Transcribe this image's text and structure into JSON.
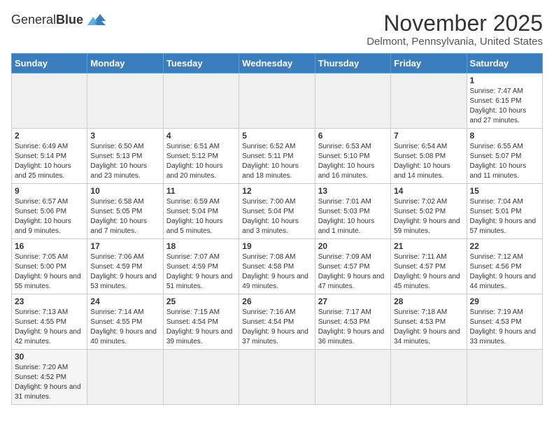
{
  "header": {
    "logo_general": "General",
    "logo_blue": "Blue",
    "month": "November 2025",
    "location": "Delmont, Pennsylvania, United States"
  },
  "days_of_week": [
    "Sunday",
    "Monday",
    "Tuesday",
    "Wednesday",
    "Thursday",
    "Friday",
    "Saturday"
  ],
  "weeks": [
    [
      {
        "day": "",
        "info": ""
      },
      {
        "day": "",
        "info": ""
      },
      {
        "day": "",
        "info": ""
      },
      {
        "day": "",
        "info": ""
      },
      {
        "day": "",
        "info": ""
      },
      {
        "day": "",
        "info": ""
      },
      {
        "day": "1",
        "info": "Sunrise: 7:47 AM\nSunset: 6:15 PM\nDaylight: 10 hours and 27 minutes."
      }
    ],
    [
      {
        "day": "2",
        "info": "Sunrise: 6:49 AM\nSunset: 5:14 PM\nDaylight: 10 hours and 25 minutes."
      },
      {
        "day": "3",
        "info": "Sunrise: 6:50 AM\nSunset: 5:13 PM\nDaylight: 10 hours and 23 minutes."
      },
      {
        "day": "4",
        "info": "Sunrise: 6:51 AM\nSunset: 5:12 PM\nDaylight: 10 hours and 20 minutes."
      },
      {
        "day": "5",
        "info": "Sunrise: 6:52 AM\nSunset: 5:11 PM\nDaylight: 10 hours and 18 minutes."
      },
      {
        "day": "6",
        "info": "Sunrise: 6:53 AM\nSunset: 5:10 PM\nDaylight: 10 hours and 16 minutes."
      },
      {
        "day": "7",
        "info": "Sunrise: 6:54 AM\nSunset: 5:08 PM\nDaylight: 10 hours and 14 minutes."
      },
      {
        "day": "8",
        "info": "Sunrise: 6:55 AM\nSunset: 5:07 PM\nDaylight: 10 hours and 11 minutes."
      }
    ],
    [
      {
        "day": "9",
        "info": "Sunrise: 6:57 AM\nSunset: 5:06 PM\nDaylight: 10 hours and 9 minutes."
      },
      {
        "day": "10",
        "info": "Sunrise: 6:58 AM\nSunset: 5:05 PM\nDaylight: 10 hours and 7 minutes."
      },
      {
        "day": "11",
        "info": "Sunrise: 6:59 AM\nSunset: 5:04 PM\nDaylight: 10 hours and 5 minutes."
      },
      {
        "day": "12",
        "info": "Sunrise: 7:00 AM\nSunset: 5:04 PM\nDaylight: 10 hours and 3 minutes."
      },
      {
        "day": "13",
        "info": "Sunrise: 7:01 AM\nSunset: 5:03 PM\nDaylight: 10 hours and 1 minute."
      },
      {
        "day": "14",
        "info": "Sunrise: 7:02 AM\nSunset: 5:02 PM\nDaylight: 9 hours and 59 minutes."
      },
      {
        "day": "15",
        "info": "Sunrise: 7:04 AM\nSunset: 5:01 PM\nDaylight: 9 hours and 57 minutes."
      }
    ],
    [
      {
        "day": "16",
        "info": "Sunrise: 7:05 AM\nSunset: 5:00 PM\nDaylight: 9 hours and 55 minutes."
      },
      {
        "day": "17",
        "info": "Sunrise: 7:06 AM\nSunset: 4:59 PM\nDaylight: 9 hours and 53 minutes."
      },
      {
        "day": "18",
        "info": "Sunrise: 7:07 AM\nSunset: 4:59 PM\nDaylight: 9 hours and 51 minutes."
      },
      {
        "day": "19",
        "info": "Sunrise: 7:08 AM\nSunset: 4:58 PM\nDaylight: 9 hours and 49 minutes."
      },
      {
        "day": "20",
        "info": "Sunrise: 7:09 AM\nSunset: 4:57 PM\nDaylight: 9 hours and 47 minutes."
      },
      {
        "day": "21",
        "info": "Sunrise: 7:11 AM\nSunset: 4:57 PM\nDaylight: 9 hours and 45 minutes."
      },
      {
        "day": "22",
        "info": "Sunrise: 7:12 AM\nSunset: 4:56 PM\nDaylight: 9 hours and 44 minutes."
      }
    ],
    [
      {
        "day": "23",
        "info": "Sunrise: 7:13 AM\nSunset: 4:55 PM\nDaylight: 9 hours and 42 minutes."
      },
      {
        "day": "24",
        "info": "Sunrise: 7:14 AM\nSunset: 4:55 PM\nDaylight: 9 hours and 40 minutes."
      },
      {
        "day": "25",
        "info": "Sunrise: 7:15 AM\nSunset: 4:54 PM\nDaylight: 9 hours and 39 minutes."
      },
      {
        "day": "26",
        "info": "Sunrise: 7:16 AM\nSunset: 4:54 PM\nDaylight: 9 hours and 37 minutes."
      },
      {
        "day": "27",
        "info": "Sunrise: 7:17 AM\nSunset: 4:53 PM\nDaylight: 9 hours and 36 minutes."
      },
      {
        "day": "28",
        "info": "Sunrise: 7:18 AM\nSunset: 4:53 PM\nDaylight: 9 hours and 34 minutes."
      },
      {
        "day": "29",
        "info": "Sunrise: 7:19 AM\nSunset: 4:53 PM\nDaylight: 9 hours and 33 minutes."
      }
    ],
    [
      {
        "day": "30",
        "info": "Sunrise: 7:20 AM\nSunset: 4:52 PM\nDaylight: 9 hours and 31 minutes."
      },
      {
        "day": "",
        "info": ""
      },
      {
        "day": "",
        "info": ""
      },
      {
        "day": "",
        "info": ""
      },
      {
        "day": "",
        "info": ""
      },
      {
        "day": "",
        "info": ""
      },
      {
        "day": "",
        "info": ""
      }
    ]
  ]
}
